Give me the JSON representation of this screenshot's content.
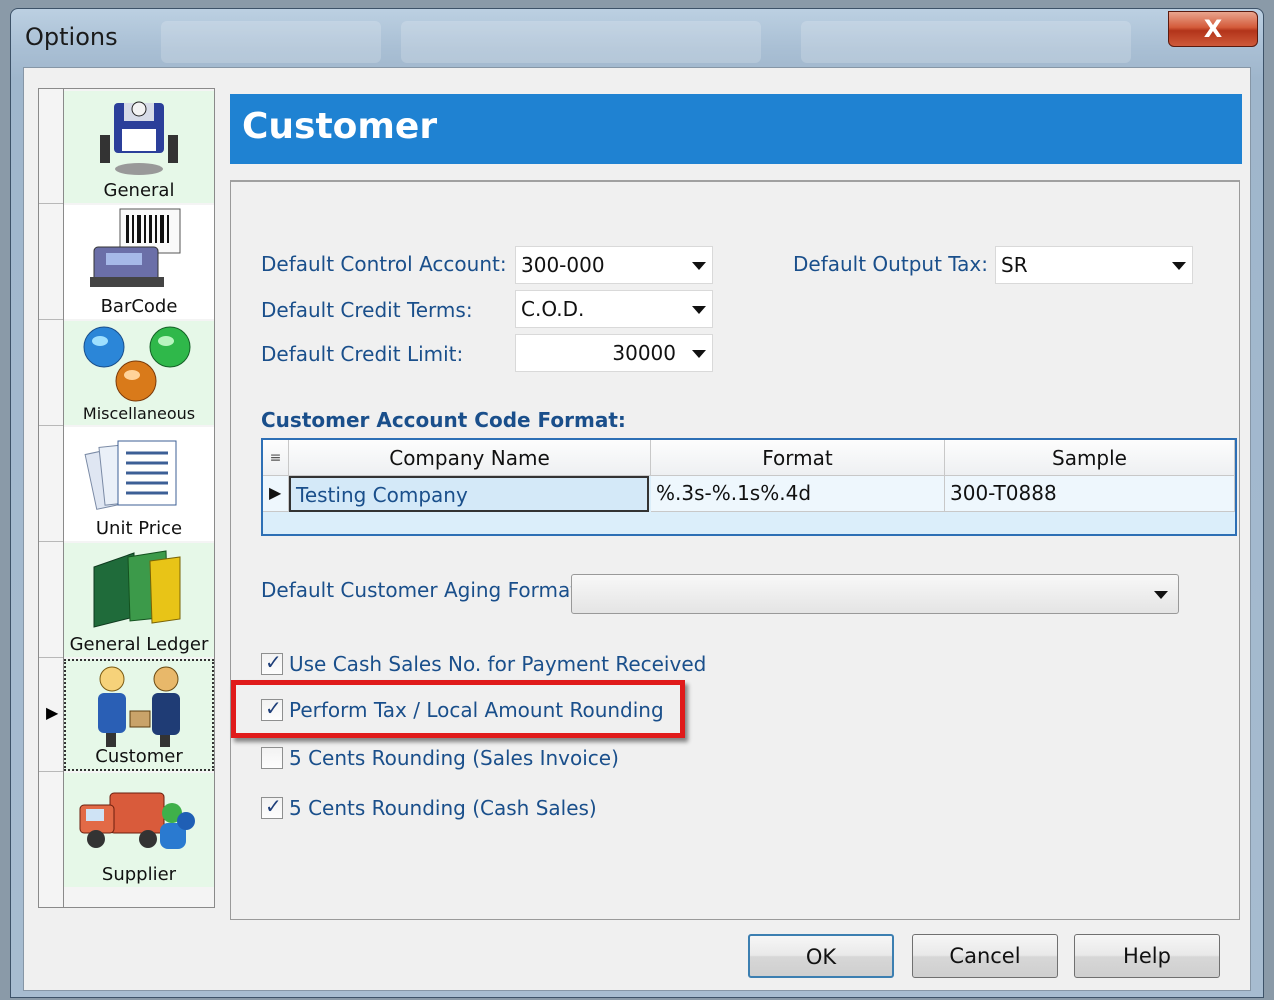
{
  "window": {
    "title": "Options",
    "close_label": "X"
  },
  "sidebar": {
    "items": [
      {
        "label": "General",
        "icon": "floppy-disk-icon"
      },
      {
        "label": "BarCode",
        "icon": "barcode-printer-icon"
      },
      {
        "label": "Miscellaneous",
        "icon": "globes-icon"
      },
      {
        "label": "Unit Price",
        "icon": "documents-icon"
      },
      {
        "label": "General Ledger",
        "icon": "ledger-books-icon"
      },
      {
        "label": "Customer",
        "icon": "customer-handshake-icon"
      },
      {
        "label": "Supplier",
        "icon": "supplier-truck-icon"
      }
    ],
    "selected": "Customer"
  },
  "header": {
    "title": "Customer"
  },
  "form": {
    "control_account_label": "Default Control Account:",
    "control_account_value": "300-000",
    "output_tax_label": "Default Output Tax:",
    "output_tax_value": "SR",
    "credit_terms_label": "Default Credit Terms:",
    "credit_terms_value": "C.O.D.",
    "credit_limit_label": "Default Credit Limit:",
    "credit_limit_value": "30000",
    "code_format_title": "Customer Account Code Format:",
    "aging_label": "Default Customer Aging Format:",
    "aging_value": ""
  },
  "grid": {
    "columns": [
      "Company Name",
      "Format",
      "Sample"
    ],
    "rows": [
      [
        "Testing Company",
        "%.3s-%.1s%.4d",
        "300-T0888"
      ]
    ]
  },
  "checkboxes": [
    {
      "label": "Use Cash Sales No. for Payment Received",
      "checked": true
    },
    {
      "label": "Perform Tax / Local Amount Rounding",
      "checked": true,
      "highlighted": true
    },
    {
      "label": "5 Cents Rounding (Sales Invoice)",
      "checked": false
    },
    {
      "label": "5 Cents Rounding (Cash Sales)",
      "checked": true
    }
  ],
  "buttons": {
    "ok": "OK",
    "cancel": "Cancel",
    "help": "Help"
  },
  "colors": {
    "header_bg": "#1f82d2",
    "label_text": "#1a4f8b",
    "highlight": "#e01b1b",
    "sidebar_item_bg": "#e6f8e8"
  }
}
